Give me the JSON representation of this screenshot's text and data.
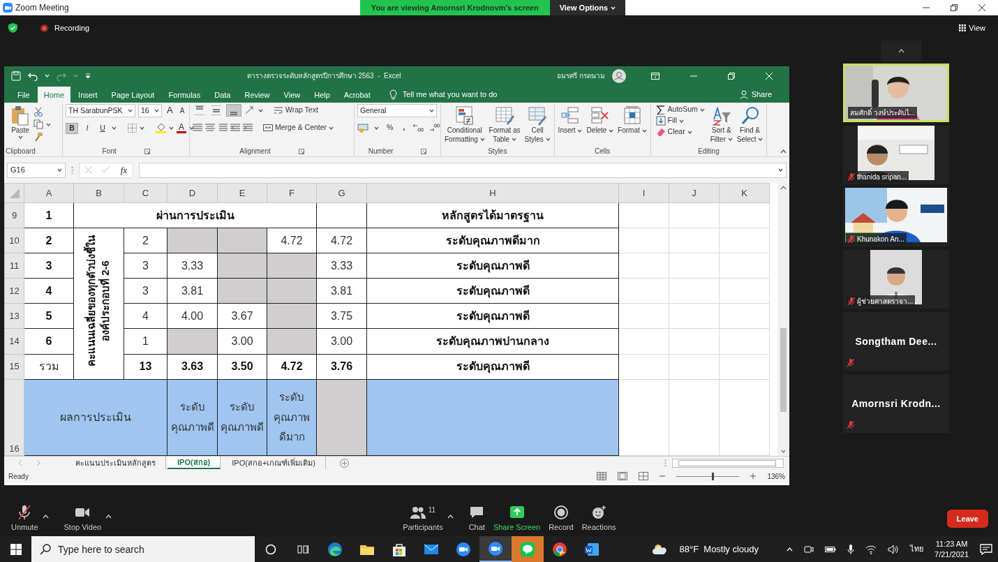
{
  "zoom": {
    "title": "Zoom Meeting",
    "banner": "You are viewing Amornsri Krodnovm's screen",
    "view_options": "View Options",
    "recording": "Recording",
    "view": "View"
  },
  "excel": {
    "title": "ตารางตรวจระดับหลักสูตรปีการศึกษา 2563  -  Excel",
    "user": "อมรศรี กรดนาม",
    "tabs": [
      {
        "label": "File",
        "selected": false
      },
      {
        "label": "Home",
        "selected": true
      },
      {
        "label": "Insert",
        "selected": false
      },
      {
        "label": "Page Layout",
        "selected": false
      },
      {
        "label": "Formulas",
        "selected": false
      },
      {
        "label": "Data",
        "selected": false
      },
      {
        "label": "Review",
        "selected": false
      },
      {
        "label": "View",
        "selected": false
      },
      {
        "label": "Help",
        "selected": false
      },
      {
        "label": "Acrobat",
        "selected": false
      }
    ],
    "tell_me": "Tell me what you want to do",
    "share": "Share",
    "ribbon": [
      {
        "kind": "clipboard",
        "label": "Clipboard",
        "paste": "Paste"
      },
      {
        "kind": "font",
        "label": "Font",
        "font": "TH SarabunPSK",
        "size": "16",
        "grow": "A",
        "shrink": "A",
        "color_letter": "A",
        "styles": [
          {
            "label": "B",
            "pressed": true
          },
          {
            "label": "I",
            "pressed": false
          },
          {
            "label": "U",
            "pressed": false
          }
        ]
      },
      {
        "kind": "alignment",
        "label": "Alignment",
        "wrap": "Wrap Text",
        "merge": "Merge & Center",
        "vertical_align": [
          {
            "selected": false
          },
          {
            "selected": false
          },
          {
            "selected": true
          }
        ]
      },
      {
        "kind": "number",
        "label": "Number",
        "format": "General",
        "percent": "%",
        "comma": ","
      },
      {
        "kind": "styles",
        "label": "Styles",
        "buttons": [
          {
            "lines": [
              "Conditional",
              "Formatting"
            ]
          },
          {
            "lines": [
              "Format as",
              "Table"
            ]
          },
          {
            "lines": [
              "Cell",
              "Styles"
            ]
          }
        ]
      },
      {
        "kind": "cells",
        "label": "Cells",
        "buttons": [
          {
            "lines": [
              "Insert"
            ]
          },
          {
            "lines": [
              "Delete"
            ]
          },
          {
            "lines": [
              "Format"
            ]
          }
        ]
      },
      {
        "kind": "editing",
        "label": "Editing",
        "small": [
          {
            "label": "AutoSum"
          },
          {
            "label": "Fill"
          },
          {
            "label": "Clear"
          }
        ],
        "buttons": [
          {
            "lines": [
              "Sort &",
              "Filter"
            ]
          },
          {
            "lines": [
              "Find &",
              "Select"
            ]
          }
        ]
      }
    ],
    "name_box": "G16",
    "formula_label": "fx",
    "columns": [
      "A",
      "B",
      "C",
      "D",
      "E",
      "F",
      "G",
      "H",
      "I",
      "J",
      "K"
    ],
    "rows": [
      {
        "number": "9",
        "cells": [
          {
            "text": "1",
            "bold": true
          },
          {
            "text": "ผ่านการประเมิน",
            "bold": true,
            "colspan": 5
          },
          {},
          {
            "text": "หลักสูตรได้มาตรฐาน",
            "bold": true
          }
        ]
      },
      {
        "number": "10",
        "cells": [
          {
            "text": "2",
            "bold": true
          },
          {
            "lines": [
              "คะแนนเฉลี่ยของทุกตัวบ่งชี้ใน",
              "องค์ประกอบที่ 2-6"
            ],
            "vertical": true,
            "bold": true,
            "rowspan": 6
          },
          {
            "text": "2"
          },
          {
            "color": "#d0cece"
          },
          {
            "color": "#d0cece"
          },
          {
            "text": "4.72"
          },
          {
            "text": "4.72"
          },
          {
            "text": "ระดับคุณภาพดีมาก",
            "bold": true
          }
        ]
      },
      {
        "number": "11",
        "cells": [
          {
            "text": "3",
            "bold": true
          },
          {
            "text": "3"
          },
          {
            "text": "3.33"
          },
          {
            "color": "#d0cece"
          },
          {
            "color": "#d0cece"
          },
          {
            "text": "3.33"
          },
          {
            "text": "ระดับคุณภาพดี",
            "bold": true
          }
        ]
      },
      {
        "number": "12",
        "cells": [
          {
            "text": "4",
            "bold": true
          },
          {
            "text": "3"
          },
          {
            "text": "3.81"
          },
          {
            "color": "#d0cece"
          },
          {
            "color": "#d0cece"
          },
          {
            "text": "3.81"
          },
          {
            "text": "ระดับคุณภาพดี",
            "bold": true
          }
        ]
      },
      {
        "number": "13",
        "cells": [
          {
            "text": "5",
            "bold": true
          },
          {
            "text": "4"
          },
          {
            "text": "4.00"
          },
          {
            "text": "3.67"
          },
          {
            "color": "#d0cece"
          },
          {
            "text": "3.75"
          },
          {
            "text": "ระดับคุณภาพดี",
            "bold": true
          }
        ]
      },
      {
        "number": "14",
        "cells": [
          {
            "text": "6",
            "bold": true
          },
          {
            "text": "1"
          },
          {
            "color": "#d0cece"
          },
          {
            "text": "3.00"
          },
          {
            "color": "#d0cece"
          },
          {
            "text": "3.00"
          },
          {
            "text": "ระดับคุณภาพปานกลาง",
            "bold": true
          }
        ]
      },
      {
        "number": "15",
        "cells": [
          {
            "text": "รวม"
          },
          {
            "text": "13",
            "bold": true
          },
          {
            "text": "3.63",
            "bold": true
          },
          {
            "text": "3.50",
            "bold": true
          },
          {
            "text": "4.72",
            "bold": true
          },
          {
            "text": "3.76",
            "bold": true
          },
          {
            "text": "ระดับคุณภาพดี",
            "bold": true
          }
        ]
      },
      {
        "number": "16",
        "tall": true,
        "cells": [
          {
            "text": "ผลการประเมิน",
            "colspan": 3,
            "color": "#9fc5f0"
          },
          {
            "lines": [
              "ระดับ",
              "คุณภาพดี"
            ],
            "color": "#9fc5f0"
          },
          {
            "lines": [
              "ระดับ",
              "คุณภาพดี"
            ],
            "color": "#9fc5f0"
          },
          {
            "lines": [
              "ระดับ",
              "คุณภาพ",
              "ดีมาก"
            ],
            "color": "#9fc5f0"
          },
          {
            "color": "#d0cece"
          },
          {
            "color": "#9fc5f0"
          }
        ]
      }
    ],
    "sheet_tabs": [
      {
        "label": "คะแนนประเมินหลักสูตร",
        "selected": false
      },
      {
        "label": "IPO(สกอ)",
        "selected": true
      },
      {
        "label": "IPO(สกอ+เกณฑ์เพิ่มเติม)",
        "selected": false
      }
    ],
    "status": "Ready",
    "zoom_slider": {
      "level": 0.56
    },
    "zoom_reading": "136%"
  },
  "participants": [
    {
      "name": "สมศักดิ์ วงษ์ประดับไ...",
      "video": true,
      "muted": false,
      "speaking": true
    },
    {
      "name": "thanida sripan...",
      "video": true,
      "muted": true,
      "speaking": false
    },
    {
      "name": "Khunakon An...",
      "video": true,
      "muted": true,
      "speaking": false
    },
    {
      "name": "ผู้ช่วยศาสตราจา...",
      "video": true,
      "muted": true,
      "speaking": false
    },
    {
      "name": "Songtham  Dee...",
      "video": false,
      "muted": true,
      "speaking": false
    },
    {
      "name": "Amornsri  Krodn...",
      "video": false,
      "muted": true,
      "speaking": false
    }
  ],
  "toolbar": [
    {
      "kind": "mic",
      "label": "Unmute",
      "caret": true
    },
    {
      "kind": "video",
      "label": "Stop Video",
      "caret": true
    },
    {
      "kind": "participants",
      "label": "Participants",
      "count": "11",
      "caret": true
    },
    {
      "kind": "chat",
      "label": "Chat",
      "caret": false
    },
    {
      "kind": "share",
      "label": "Share Screen",
      "caret": false
    },
    {
      "kind": "record",
      "label": "Record",
      "caret": false
    },
    {
      "kind": "reactions",
      "label": "Reactions",
      "caret": false
    }
  ],
  "leave": "Leave",
  "taskbar": {
    "search": {
      "placeholder": "Type here to search"
    },
    "apps": [
      {
        "kind": "edge",
        "selected": false,
        "flashing": false
      },
      {
        "kind": "folder",
        "selected": false,
        "flashing": false
      },
      {
        "kind": "store",
        "selected": false,
        "flashing": false
      },
      {
        "kind": "mail",
        "selected": false,
        "flashing": false
      },
      {
        "kind": "zoom",
        "selected": false,
        "flashing": false
      },
      {
        "kind": "zoom",
        "selected": true,
        "flashing": false
      },
      {
        "kind": "line",
        "selected": false,
        "flashing": true
      },
      {
        "kind": "chrome",
        "selected": false,
        "flashing": false
      },
      {
        "kind": "word",
        "selected": false,
        "flashing": false
      }
    ],
    "weather": "88°F  Mostly cloudy",
    "language": "ไทย",
    "time": "11:23 AM",
    "date": "7/21/2021"
  }
}
